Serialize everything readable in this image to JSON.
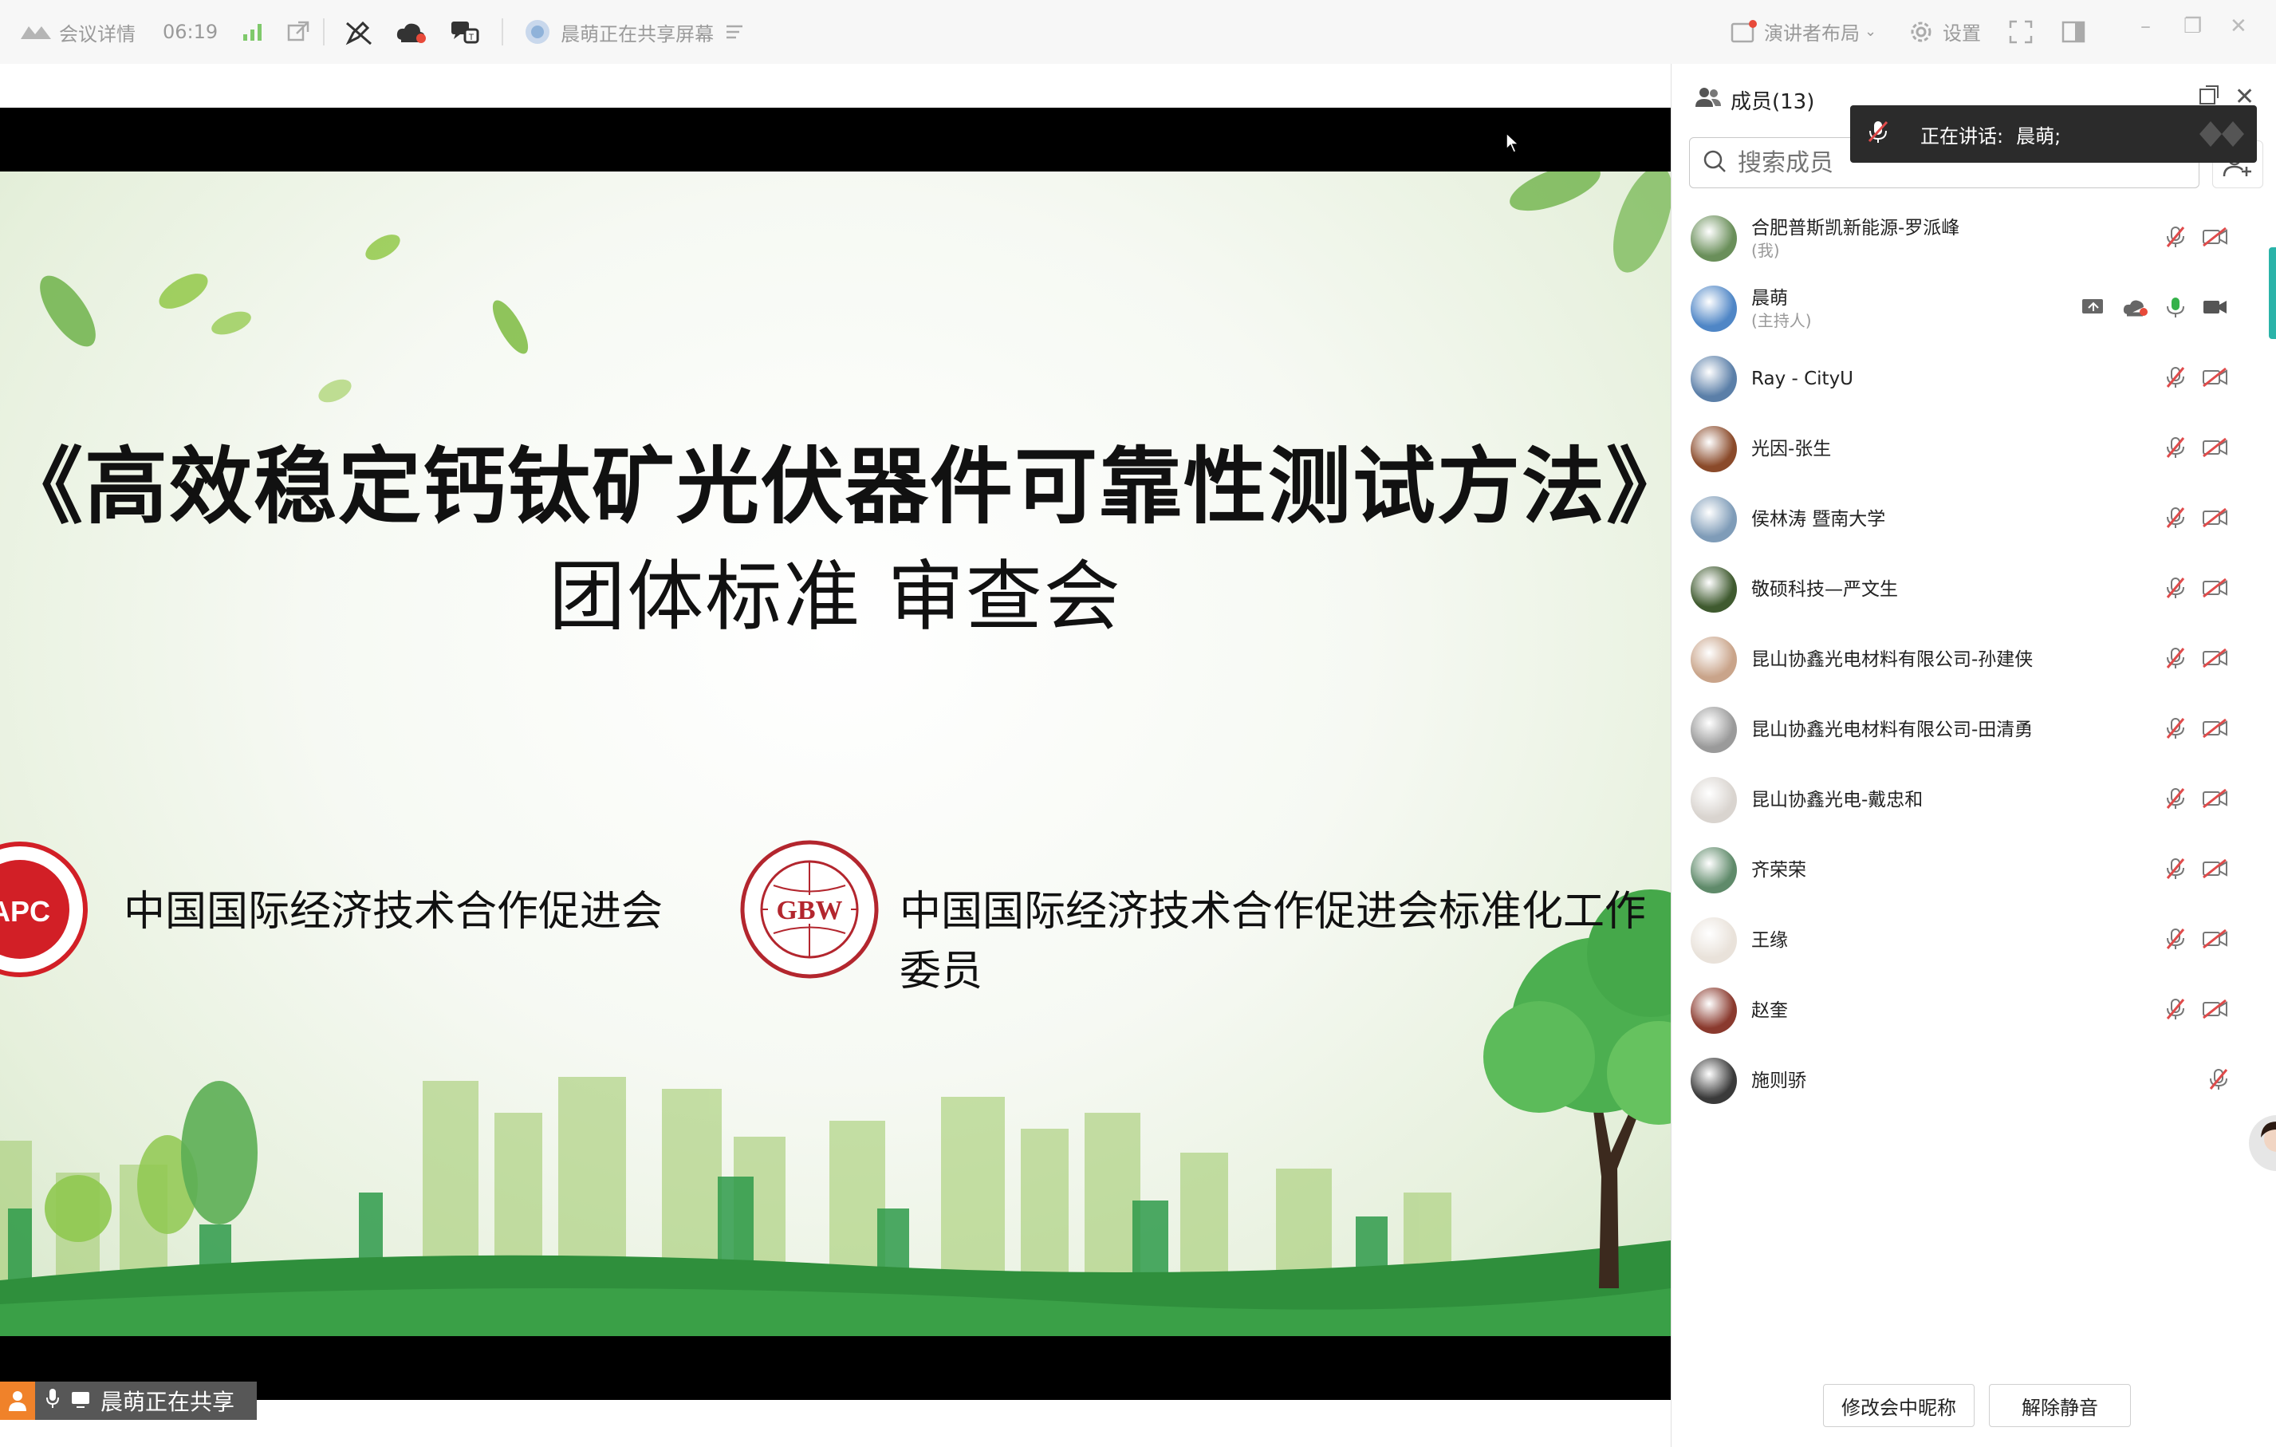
{
  "topbar": {
    "meeting_details": "会议详情",
    "timer": "06:19",
    "sharing_status": "晨萌正在共享屏幕",
    "layout_label": "演讲者布局",
    "settings_label": "设置"
  },
  "slide": {
    "title": "《高效稳定钙钛矿光伏器件可靠性测试方法》",
    "subtitle": "团体标准 审查会",
    "org1": "中国国际经济技术合作促进会",
    "org2": "中国国际经济技术合作促进会标准化工作委员",
    "logo1_text": "APC",
    "logo2_text": "GBW"
  },
  "share_status": {
    "text": "晨萌正在共享"
  },
  "panel": {
    "title": "成员(13)",
    "search_placeholder": "搜索成员",
    "speaking_label": "正在讲话:",
    "speaking_name": "晨萌;",
    "members": [
      {
        "name": "合肥普斯凯新能源-罗派峰",
        "role": "(我)",
        "avatar_color": "#6a8f5a",
        "host": false
      },
      {
        "name": "晨萌",
        "role": "(主持人)",
        "avatar_color": "#4f86c6",
        "host": true
      },
      {
        "name": "Ray - CityU",
        "role": "",
        "avatar_color": "#5b7fa8",
        "host": false
      },
      {
        "name": "光因-张生",
        "role": "",
        "avatar_color": "#8a4a2a",
        "host": false
      },
      {
        "name": "侯林涛 暨南大学",
        "role": "",
        "avatar_color": "#7f9cb8",
        "host": false
      },
      {
        "name": "敬硕科技—严文生",
        "role": "",
        "avatar_color": "#3f5a2f",
        "host": false
      },
      {
        "name": "昆山协鑫光电材料有限公司-孙建侠",
        "role": "",
        "avatar_color": "#c9a48a",
        "host": false
      },
      {
        "name": "昆山协鑫光电材料有限公司-田清勇",
        "role": "",
        "avatar_color": "#9a9a9a",
        "host": false
      },
      {
        "name": "昆山协鑫光电-戴忠和",
        "role": "",
        "avatar_color": "#d9d4cf",
        "host": false
      },
      {
        "name": "齐荣荣",
        "role": "",
        "avatar_color": "#5f8a6a",
        "host": false
      },
      {
        "name": "王缘",
        "role": "",
        "avatar_color": "#e9e2da",
        "host": false
      },
      {
        "name": "赵奎",
        "role": "",
        "avatar_color": "#8a3a2e",
        "host": false
      },
      {
        "name": "施则骄",
        "role": "",
        "avatar_color": "#3a3a3a",
        "host": false
      }
    ],
    "rename_button": "修改会中昵称",
    "unmute_button": "解除静音"
  },
  "colors": {
    "accent": "#1a73e8",
    "muted_red": "#e04b4b",
    "mic_green": "#35b24a",
    "slide_green": "#4caf50"
  }
}
